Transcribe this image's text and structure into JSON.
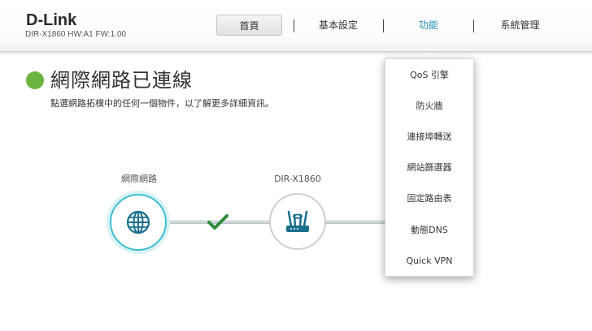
{
  "header": {
    "logo": "D-Link",
    "model_info": "DIR-X1860 HW:A1 FW:1.00"
  },
  "nav": {
    "home": "首頁",
    "basic": "基本設定",
    "features": "功能",
    "system": "系統管理"
  },
  "main": {
    "title": "網際網路已連線",
    "subtitle": "點選網路拓樸中的任何一個物件，以了解更多詳細資訊。",
    "status_color": "#6cb33f"
  },
  "topology": {
    "internet_label": "網際網路",
    "router_label": "DIR-X1860",
    "internet_icon": "globe-icon",
    "router_icon": "router-icon",
    "connection_status_icon": "checkmark-icon",
    "accent_color": "#3bbfd1"
  },
  "features_menu": {
    "items": [
      "QoS 引擎",
      "防火牆",
      "連接埠轉送",
      "網站篩選器",
      "固定路由表",
      "動態DNS",
      "Quick VPN"
    ]
  }
}
